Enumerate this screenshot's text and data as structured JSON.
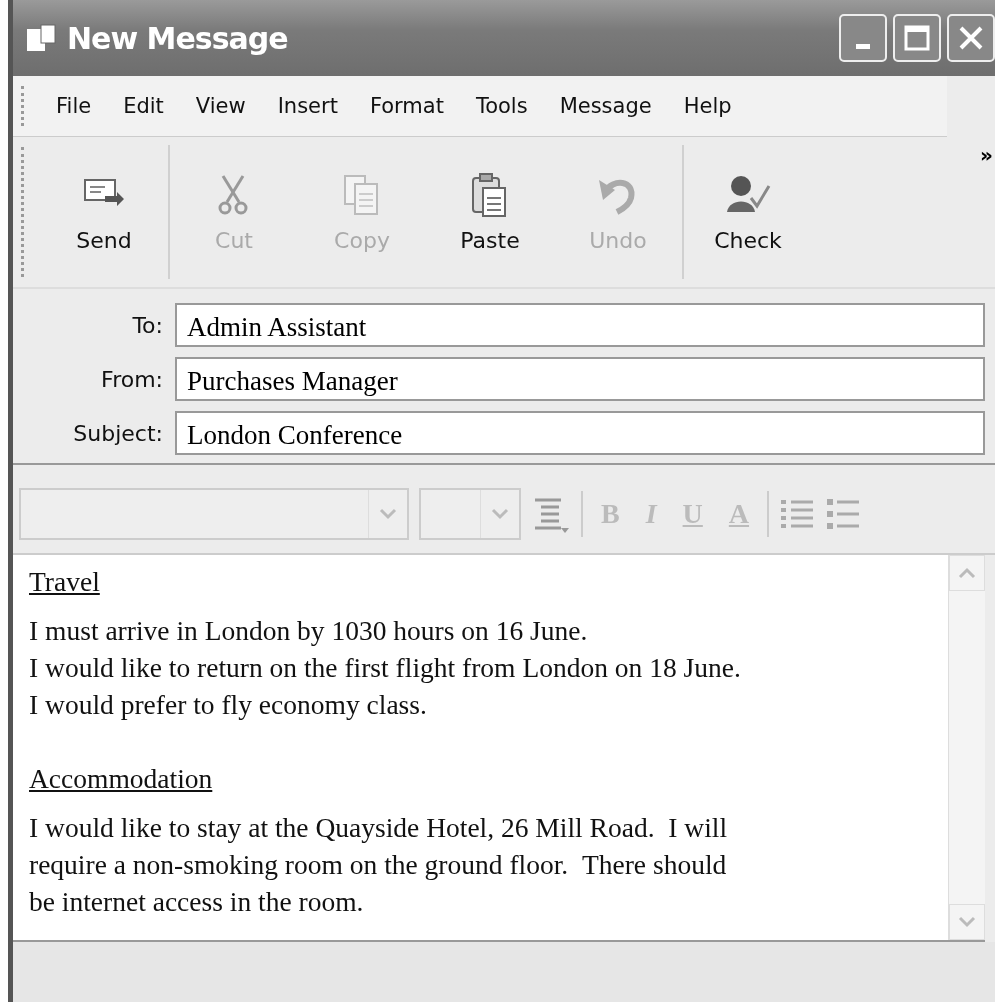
{
  "window": {
    "title": "New Message"
  },
  "menu": [
    "File",
    "Edit",
    "View",
    "Insert",
    "Format",
    "Tools",
    "Message",
    "Help"
  ],
  "toolbar": [
    {
      "kind": "send",
      "label": "Send",
      "disabled": false,
      "group_start": false
    },
    {
      "kind": "cut",
      "label": "Cut",
      "disabled": true,
      "group_start": true
    },
    {
      "kind": "copy",
      "label": "Copy",
      "disabled": true,
      "group_start": false
    },
    {
      "kind": "paste",
      "label": "Paste",
      "disabled": false,
      "group_start": false
    },
    {
      "kind": "undo",
      "label": "Undo",
      "disabled": true,
      "group_start": false
    },
    {
      "kind": "check",
      "label": "Check",
      "disabled": false,
      "group_start": true
    }
  ],
  "toolbar_overflow": "»",
  "fields": [
    {
      "label": "To:",
      "value": "Admin Assistant"
    },
    {
      "label": "From:",
      "value": "Purchases Manager"
    },
    {
      "label": "Subject:",
      "value": "London Conference"
    }
  ],
  "format_bar": {
    "buttons": [
      {
        "kind": "bold",
        "glyph": "B",
        "disabled": true
      },
      {
        "kind": "italic",
        "glyph": "I",
        "disabled": true
      },
      {
        "kind": "underline",
        "glyph": "U",
        "disabled": true
      },
      {
        "kind": "color",
        "glyph": "A",
        "disabled": true
      }
    ]
  },
  "body": [
    {
      "kind": "heading",
      "text": "Travel"
    },
    {
      "kind": "paragraph",
      "lines": [
        "I must arrive in London by 1030 hours on 16 June.",
        "I would like to return on the first flight from London on 18 June.",
        "I would prefer to fly economy class."
      ]
    },
    {
      "kind": "heading",
      "text": "Accommodation"
    },
    {
      "kind": "paragraph",
      "lines": [
        "I would like to stay at the Quayside Hotel, 26 Mill Road.  I will",
        "require a non-smoking room on the ground floor.  There should",
        "be internet access in the room."
      ]
    }
  ]
}
